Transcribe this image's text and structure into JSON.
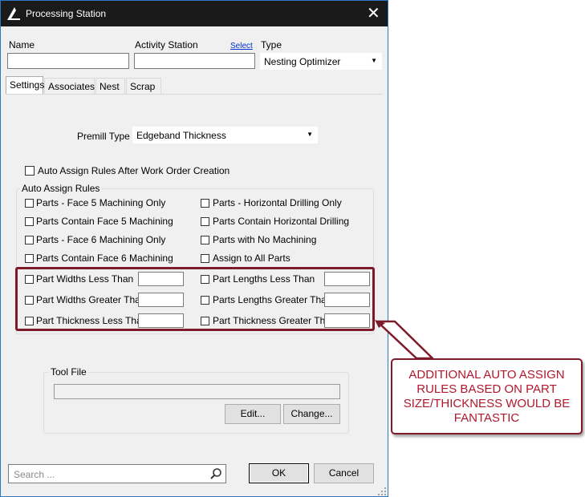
{
  "window": {
    "title": "Processing Station",
    "close_glyph": "✕",
    "logo_icon": "app-logo-icon"
  },
  "header": {
    "name_label": "Name",
    "name_value": "",
    "activity_station_label": "Activity Station",
    "select_link": "Select",
    "activity_station_value": "",
    "type_label": "Type",
    "type_value": "Nesting Optimizer"
  },
  "tabs": [
    {
      "label": "Settings",
      "active": true
    },
    {
      "label": "Associates",
      "active": false
    },
    {
      "label": "Nest",
      "active": false
    },
    {
      "label": "Scrap",
      "active": false
    }
  ],
  "settings": {
    "premill_label": "Premill Type",
    "premill_value": "Edgeband Thickness",
    "auto_assign_after_wo": {
      "label": "Auto Assign Rules After Work Order Creation",
      "checked": false
    },
    "auto_assign_group_title": "Auto Assign Rules",
    "rules_left": [
      {
        "label": "Parts - Face 5 Machining Only",
        "checked": false
      },
      {
        "label": "Parts Contain Face 5 Machining",
        "checked": false
      },
      {
        "label": "Parts - Face 6 Machining Only",
        "checked": false
      },
      {
        "label": "Parts Contain Face 6 Machining",
        "checked": false
      }
    ],
    "rules_right": [
      {
        "label": "Parts - Horizontal Drilling Only",
        "checked": false
      },
      {
        "label": "Parts Contain Horizontal Drilling",
        "checked": false
      },
      {
        "label": "Parts with No Machining",
        "checked": false
      },
      {
        "label": "Assign to All Parts",
        "checked": false
      }
    ],
    "size_rules_left": [
      {
        "label": "Part Widths Less Than",
        "value": ""
      },
      {
        "label": "Part Widths Greater Than",
        "value": ""
      },
      {
        "label": "Part Thickness Less Than",
        "value": ""
      }
    ],
    "size_rules_right": [
      {
        "label": "Part Lengths Less Than",
        "value": ""
      },
      {
        "label": "Parts Lengths Greater Than",
        "value": ""
      },
      {
        "label": "Part Thickness Greater Than",
        "value": ""
      }
    ],
    "tool_file": {
      "title": "Tool File",
      "value": "",
      "edit_button": "Edit...",
      "change_button": "Change..."
    }
  },
  "footer": {
    "search_placeholder": "Search ...",
    "ok_button": "OK",
    "cancel_button": "Cancel"
  },
  "annotation": {
    "callout_lines": [
      "ADDITIONAL AUTO ASSIGN",
      "RULES BASED ON PART",
      "SIZE/THICKNESS WOULD BE",
      "FANTASTIC"
    ],
    "color": "#7d1b2b",
    "text_color": "#b0182b"
  },
  "colors": {
    "titlebar": "#1a1a1a",
    "window_bg": "#f0f0f0",
    "window_border": "#2b78c5"
  }
}
